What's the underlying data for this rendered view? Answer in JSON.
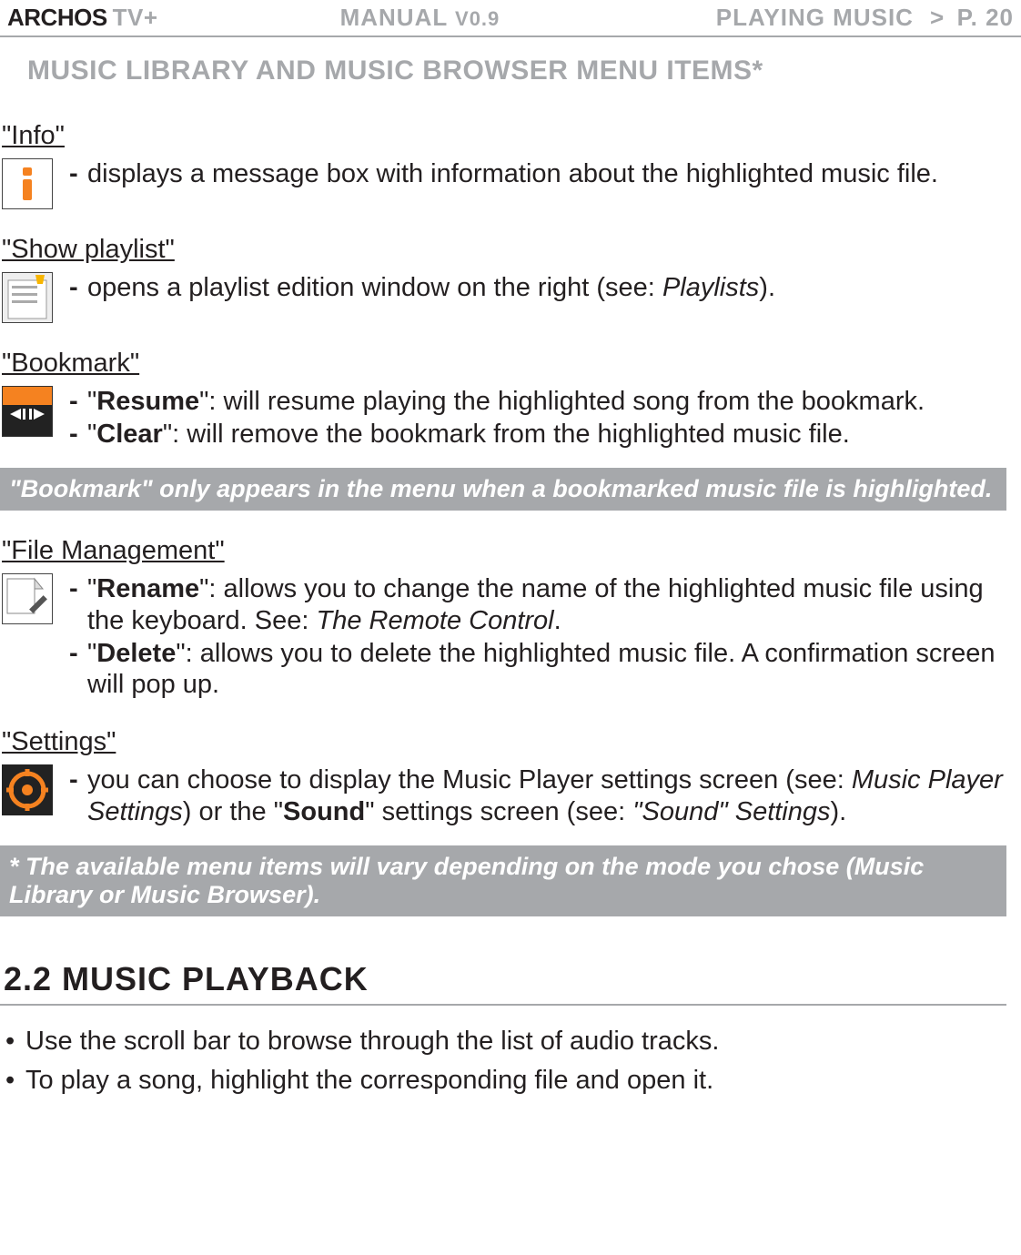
{
  "header": {
    "logo_main": "ARCHOS",
    "logo_sub": "TV+",
    "manual": "MANUAL",
    "version": "V0.9",
    "section": "PLAYING MUSIC",
    "gt": ">",
    "page": "P. 20"
  },
  "section_title": "MUSIC LIBRARY AND MUSIC BROWSER MENU ITEMS*",
  "info": {
    "heading": "\"Info\"",
    "line": "displays a message box with information about the highlighted music file."
  },
  "show_playlist": {
    "heading": "\"Show playlist\"",
    "line_pre": "opens a playlist edition window on the right (see: ",
    "line_link": "Playlists",
    "line_post": ")."
  },
  "bookmark": {
    "heading": "\"Bookmark\"",
    "resume_label": "Resume",
    "resume_text": "\": will resume playing the highlighted song from the bookmark.",
    "clear_label": "Clear",
    "clear_text": "\": will remove the bookmark from the highlighted music file."
  },
  "note_bookmark": "\"Bookmark\" only appears in the menu when a bookmarked music file is highlighted.",
  "file_mgmt": {
    "heading": "\"File Management\"",
    "rename_label": "Rename",
    "rename_text1": "\": allows you to change the name of the highlighted music file using the keyboard. See: ",
    "rename_link": "The Remote Control",
    "rename_text2": ".",
    "delete_label": "Delete",
    "delete_text": "\": allows you to delete the highlighted music file. A confirmation screen will pop up."
  },
  "settings": {
    "heading": "\"Settings\"",
    "pre": "you can choose to display the Music Player settings screen (see: ",
    "link1": "Music Player Settings",
    "mid": ") or the \"",
    "sound": "Sound",
    "after": "\" settings screen (see: ",
    "link2": "\"Sound\" Settings",
    "post": ")."
  },
  "note_star": "* The available menu items will vary depending on the mode you chose (Music Library or Music Browser).",
  "chapter": "2.2 MUSIC PLAYBACK",
  "bullets": {
    "b1": "Use the scroll bar to browse through the list of audio tracks.",
    "b2": "To play a song, highlight the corresponding file and open it."
  }
}
